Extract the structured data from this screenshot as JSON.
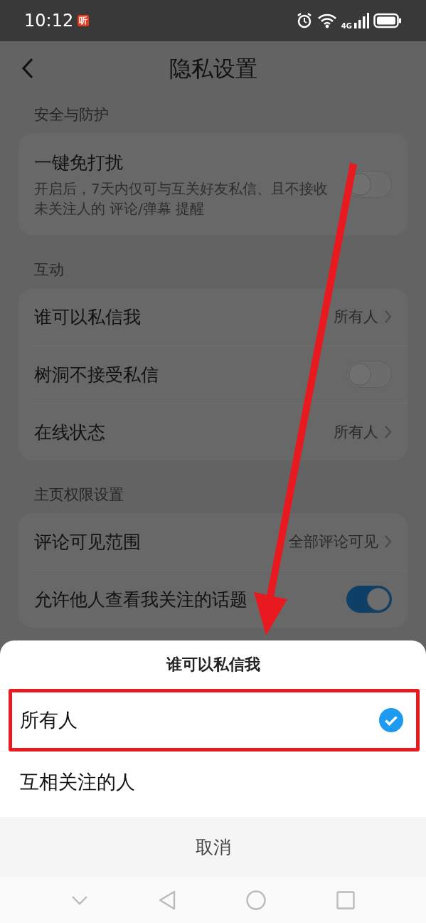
{
  "status_bar": {
    "time": "10:12",
    "app_badge": "听",
    "network": "4G"
  },
  "header": {
    "title": "隐私设置"
  },
  "sections": [
    {
      "title": "安全与防护",
      "items": [
        {
          "kind": "toggle",
          "label": "一键免打扰",
          "description": "开启后，7天内仅可与互关好友私信、且不接收未关注人的 评论/弹幕 提醒",
          "on": false
        }
      ]
    },
    {
      "title": "互动",
      "items": [
        {
          "kind": "link",
          "label": "谁可以私信我",
          "value": "所有人"
        },
        {
          "kind": "toggle",
          "label": "树洞不接受私信",
          "on": false
        },
        {
          "kind": "link",
          "label": "在线状态",
          "value": "所有人"
        }
      ]
    },
    {
      "title": "主页权限设置",
      "items": [
        {
          "kind": "link",
          "label": "评论可见范围",
          "value": "全部评论可见"
        },
        {
          "kind": "toggle",
          "label": "允许他人查看我关注的话题",
          "on": true
        }
      ]
    }
  ],
  "sheet": {
    "title": "谁可以私信我",
    "options": [
      {
        "label": "所有人",
        "selected": true
      },
      {
        "label": "互相关注的人",
        "selected": false
      }
    ],
    "cancel": "取消"
  },
  "annotations": {
    "frame": true,
    "arrow": true
  }
}
